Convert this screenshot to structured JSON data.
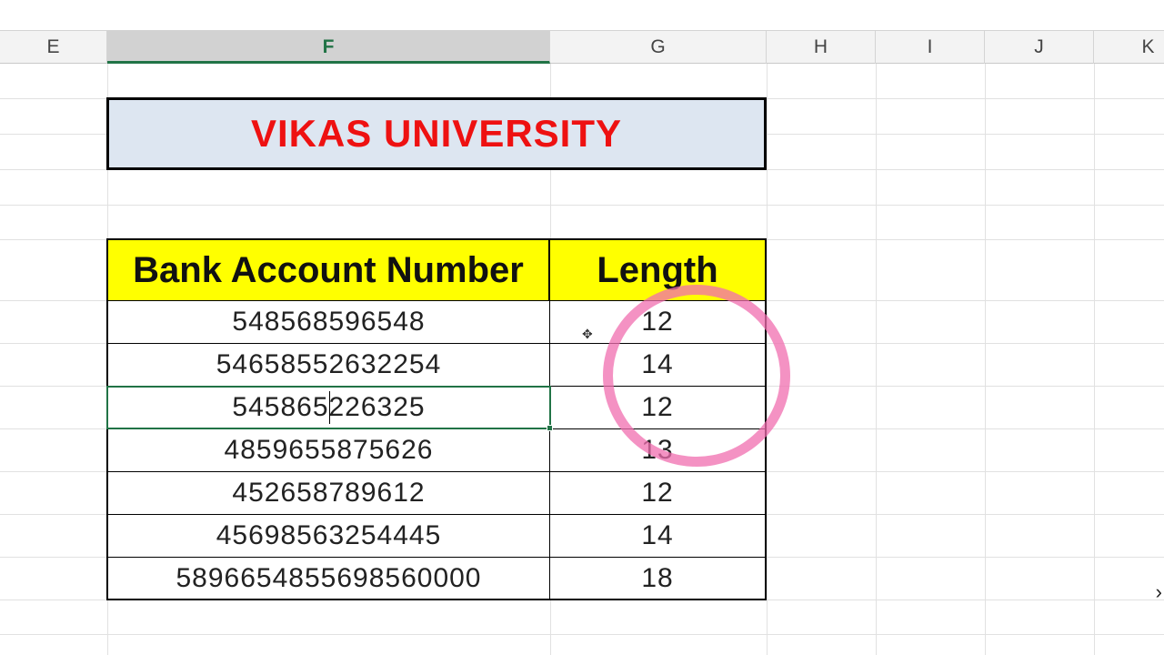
{
  "columns": [
    "E",
    "F",
    "G",
    "H",
    "I",
    "J",
    "K"
  ],
  "selected_column": "F",
  "title": "VIKAS UNIVERSITY",
  "table": {
    "headers": {
      "account": "Bank Account Number",
      "length": "Length"
    },
    "rows": [
      {
        "account": "548568596548",
        "length": "12"
      },
      {
        "account": "54658552632254",
        "length": "14"
      },
      {
        "account": "545865226325",
        "length": "12"
      },
      {
        "account": "4859655875626",
        "length": "13"
      },
      {
        "account": "452658789612",
        "length": "12"
      },
      {
        "account": "45698563254445",
        "length": "14"
      },
      {
        "account": "5896654855698560000",
        "length": "18"
      }
    ]
  },
  "colors": {
    "title_text": "#ee1111",
    "title_bg": "#dde6f1",
    "header_bg": "#ffff00",
    "selection": "#217346",
    "highlight_circle": "#f06eaf"
  },
  "icons": {
    "cursor": "move-cursor-icon"
  }
}
